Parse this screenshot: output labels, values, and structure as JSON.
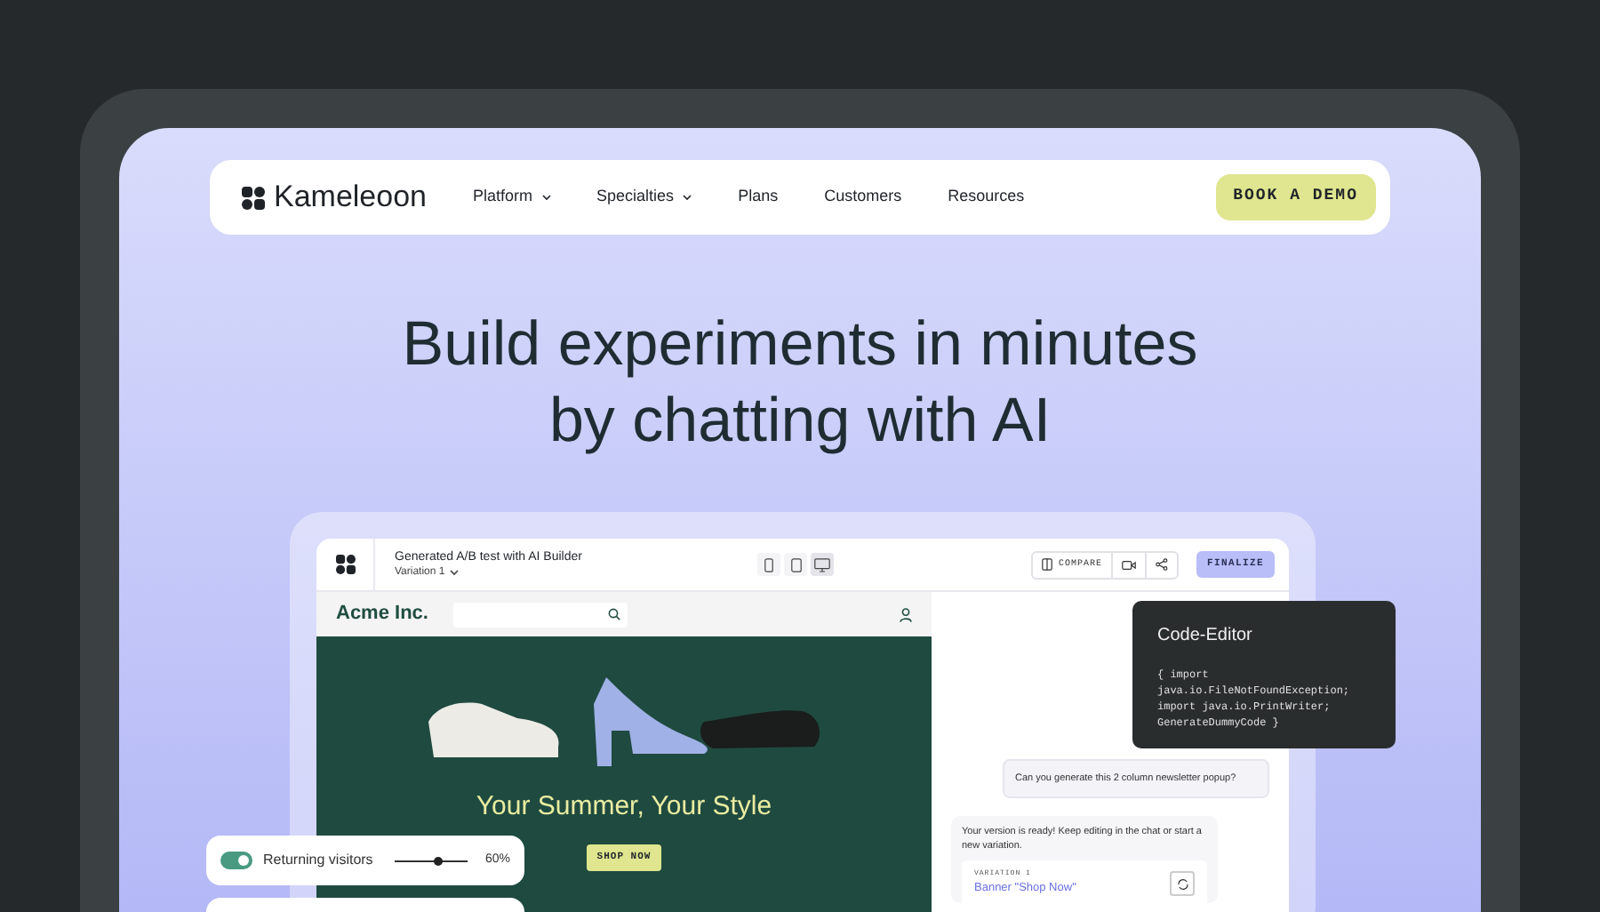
{
  "nav": {
    "logo": "Kameleoon",
    "items": [
      {
        "label": "Platform",
        "dropdown": true
      },
      {
        "label": "Specialties",
        "dropdown": true
      },
      {
        "label": "Plans",
        "dropdown": false
      },
      {
        "label": "Customers",
        "dropdown": false
      },
      {
        "label": "Resources",
        "dropdown": false
      }
    ],
    "cta": "BOOK A DEMO"
  },
  "headline": [
    "Build experiments in minutes",
    "by chatting with AI"
  ],
  "app": {
    "title": "Generated A/B test with AI Builder",
    "variation": "Variation 1",
    "devices": [
      {
        "kind": "mobile",
        "selected": false
      },
      {
        "kind": "tablet",
        "selected": false
      },
      {
        "kind": "desktop",
        "selected": true
      }
    ],
    "compare": "COMPARE",
    "finalize": "FINALIZE"
  },
  "site": {
    "brand": "Acme Inc.",
    "banner_title": "Your Summer, Your Style",
    "banner_button": "SHOP NOW"
  },
  "chat": {
    "user_message": "Can you generate this 2 column newsletter popup?",
    "reply": "Your version is ready! Keep editing in the chat or start a new variation.",
    "variation_label": "VARIATION 1",
    "variation_link": "Banner \"Shop Now\""
  },
  "code_editor": {
    "title": "Code-Editor",
    "code": "{ import\njava.io.FileNotFoundException;\nimport java.io.PrintWriter;\nGenerateDummyCode }"
  },
  "audience": {
    "on": true,
    "label": "Returning visitors",
    "level": 0.6,
    "reading": "60%"
  }
}
